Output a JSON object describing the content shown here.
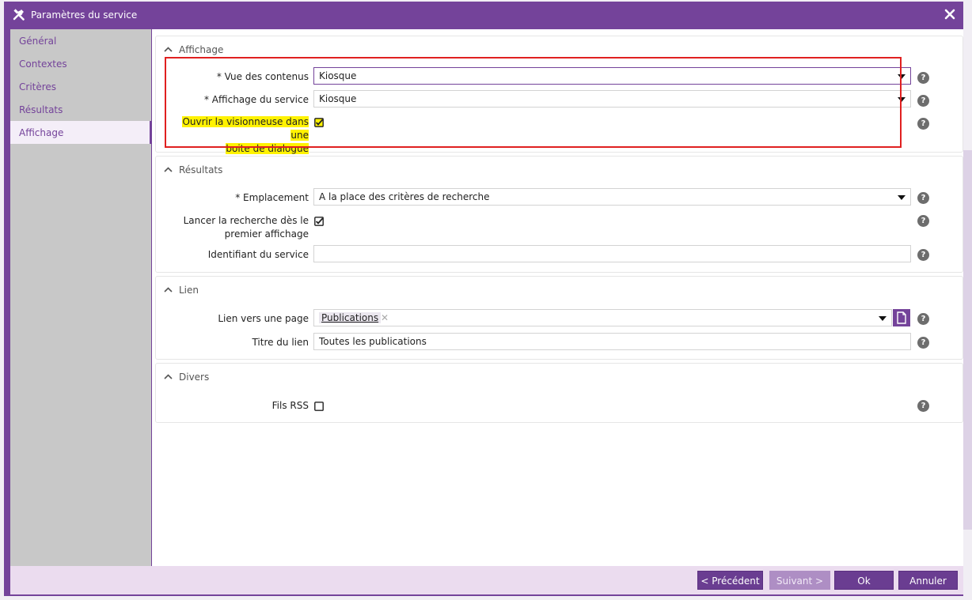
{
  "dialog": {
    "title": "Paramètres du service",
    "close_icon": "close-icon",
    "title_icon": "tools-icon"
  },
  "sidebar": {
    "items": [
      {
        "label": "Général",
        "active": false
      },
      {
        "label": "Contextes",
        "active": false
      },
      {
        "label": "Critères",
        "active": false
      },
      {
        "label": "Résultats",
        "active": false
      },
      {
        "label": "Affichage",
        "active": true
      }
    ]
  },
  "sections": {
    "affichage": {
      "title": "Affichage",
      "vue_label": "* Vue des contenus",
      "vue_value": "Kiosque",
      "affichage_label": "* Affichage du service",
      "affichage_value": "Kiosque",
      "visionneuse_label_1": "Ouvrir la visionneuse dans une",
      "visionneuse_label_2": "boite de dialogue",
      "visionneuse_checked": true
    },
    "resultats": {
      "title": "Résultats",
      "emplacement_label": "* Emplacement",
      "emplacement_value": "A la place des critères de recherche",
      "lancer_label_1": "Lancer la recherche dès le",
      "lancer_label_2": "premier affichage",
      "lancer_checked": true,
      "identifiant_label": "Identifiant du service",
      "identifiant_value": ""
    },
    "lien": {
      "title": "Lien",
      "page_label": "Lien vers une page",
      "page_tag": "Publications",
      "titre_label": "Titre du lien",
      "titre_value": "Toutes les publications"
    },
    "divers": {
      "title": "Divers",
      "rss_label": "Fils RSS",
      "rss_checked": false
    }
  },
  "help_glyph": "?",
  "footer": {
    "prev": "< Précédent",
    "next": "Suivant >",
    "ok": "Ok",
    "cancel": "Annuler"
  },
  "colors": {
    "brand": "#74439a",
    "highlight": "#fff200",
    "annotation": "#e02020"
  }
}
